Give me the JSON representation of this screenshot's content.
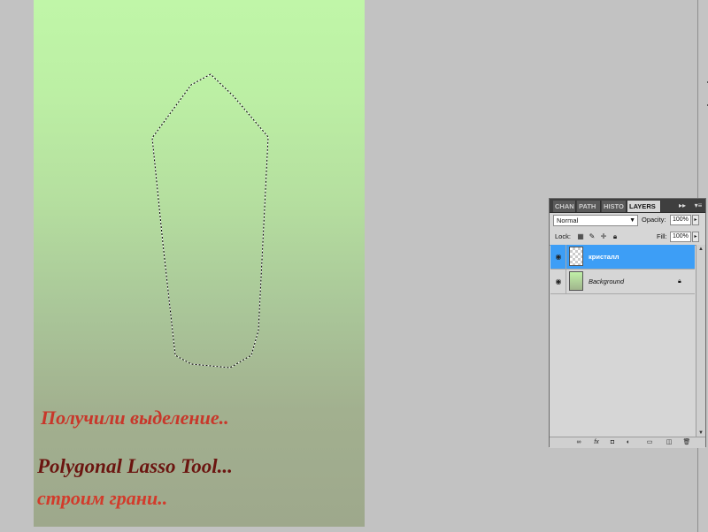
{
  "canvas": {
    "captions": {
      "line1": "Получили выделение..",
      "line2": "Polygonal Lasso Tool...",
      "line3": "строим грани.."
    }
  },
  "layers_panel": {
    "tabs": [
      {
        "label": "CHAN",
        "active": false
      },
      {
        "label": "PATH",
        "active": false
      },
      {
        "label": "HISTO",
        "active": false
      },
      {
        "label": "LAYERS",
        "active": true
      }
    ],
    "blend_mode": "Normal",
    "opacity_label": "Opacity:",
    "opacity_value": "100%",
    "lock_label": "Lock:",
    "fill_label": "Fill:",
    "fill_value": "100%",
    "layers": [
      {
        "name": "кристалл",
        "selected": true,
        "visible": true
      },
      {
        "name": "Background",
        "selected": false,
        "visible": true,
        "locked": true
      }
    ],
    "icons": {
      "collapse": "double-arrow-right-icon",
      "menu": "panel-menu-icon",
      "bottom": [
        "link-icon",
        "fx-icon",
        "mask-icon",
        "adjustment-icon",
        "group-folder-icon",
        "new-layer-icon",
        "trash-icon"
      ]
    }
  }
}
